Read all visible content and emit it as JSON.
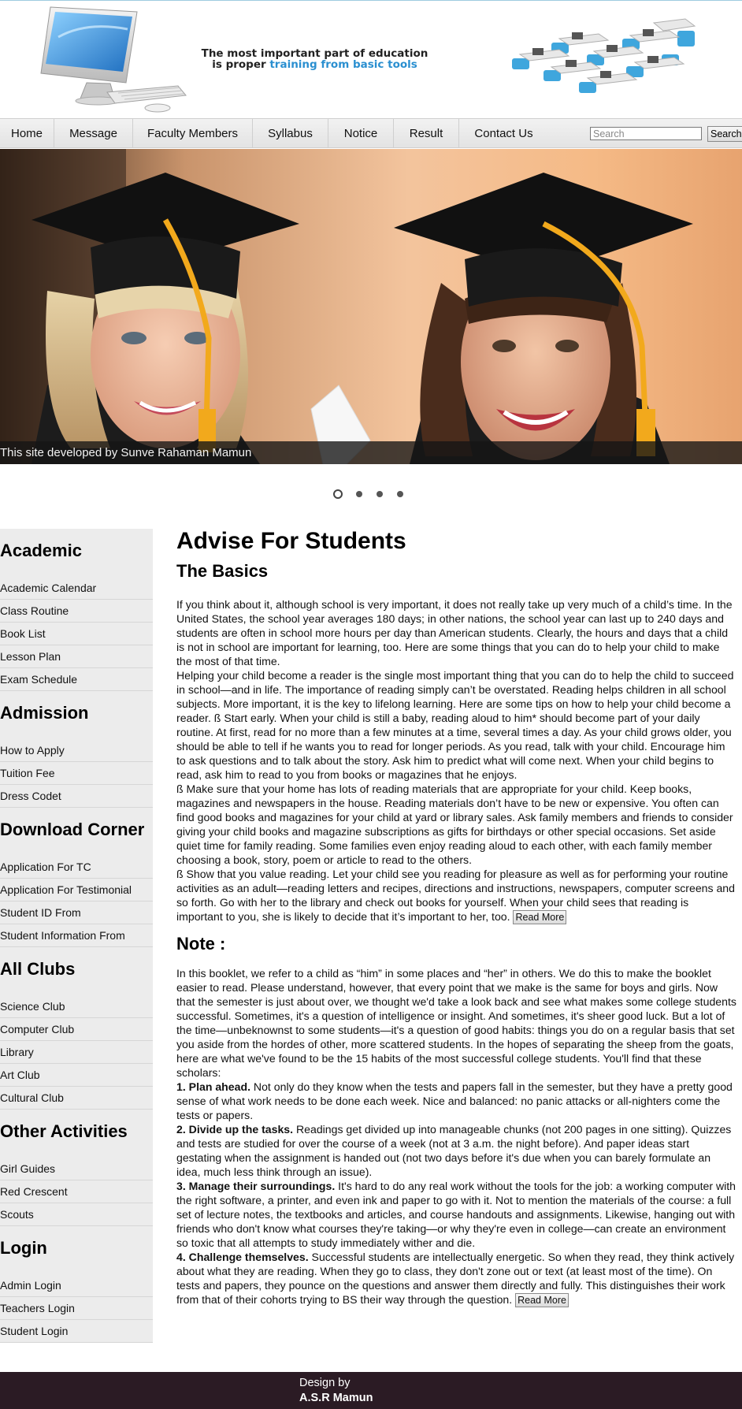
{
  "header": {
    "tagline_line1": "The most important part of education",
    "tagline_prefix": "is proper ",
    "tagline_highlight": "training from basic tools"
  },
  "nav": {
    "items": [
      "Home",
      "Message",
      "Faculty Members",
      "Syllabus",
      "Notice",
      "Result",
      "Contact Us"
    ],
    "search_placeholder": "Search",
    "search_button": "Search"
  },
  "slider": {
    "caption": "This site developed by Sunve Rahaman Mamun",
    "slide_count": 4,
    "active_slide": 1
  },
  "sidebar": {
    "sections": [
      {
        "title": "Academic",
        "links": [
          "Academic Calendar",
          "Class Routine",
          "Book List",
          "Lesson Plan",
          "Exam Schedule"
        ]
      },
      {
        "title": "Admission",
        "links": [
          "How to Apply",
          "Tuition Fee",
          "Dress Codet"
        ]
      },
      {
        "title": "Download Corner",
        "links": [
          "Application For TC",
          "Application For Testimonial",
          "Student ID From",
          "Student Information From"
        ]
      },
      {
        "title": "All Clubs",
        "links": [
          "Science Club",
          "Computer Club",
          "Library",
          "Art Club",
          "Cultural Club"
        ]
      },
      {
        "title": "Other Activities",
        "links": [
          "Girl Guides",
          "Red Crescent",
          "Scouts"
        ]
      },
      {
        "title": "Login",
        "links": [
          "Admin Login",
          "Teachers Login",
          "Student Login"
        ]
      }
    ]
  },
  "main": {
    "title": "Advise For Students",
    "subtitle": "The Basics",
    "basics_paragraphs": [
      "If you think about it, although school is very important, it does not really take up very much of a child’s time. In the United States, the school year averages 180 days; in other nations, the school year can last up to 240 days and students are often in school more hours per day than American students. Clearly, the hours and days that a child is not in school are important for learning, too. Here are some things that you can do to help your child to make the most of that time.",
      "Helping your child become a reader is the single most important thing that you can do to help the child to succeed in school—and in life. The importance of reading simply can’t be overstated. Reading helps children in all school subjects. More important, it is the key to lifelong learning. Here are some tips on how to help your child become a reader. ß Start early. When your child is still a baby, reading aloud to him* should become part of your daily routine. At first, read for no more than a few minutes at a time, several times a day. As your child grows older, you should be able to tell if he wants you to read for longer periods. As you read, talk with your child. Encourage him to ask questions and to talk about the story. Ask him to predict what will come next. When your child begins to read, ask him to read to you from books or magazines that he enjoys.",
      "ß Make sure that your home has lots of reading materials that are appropriate for your child. Keep books, magazines and newspapers in the house. Reading materials don’t have to be new or expensive. You often can find good books and magazines for your child at yard or library sales. Ask family members and friends to consider giving your child books and magazine subscriptions as gifts for birthdays or other special occasions. Set aside quiet time for family reading. Some families even enjoy reading aloud to each other, with each family member choosing a book, story, poem or article to read to the others.",
      "ß Show that you value reading. Let your child see you reading for pleasure as well as for performing your routine activities as an adult—reading letters and recipes, directions and instructions, newspapers, computer screens and so forth. Go with her to the library and check out books for yourself. When your child sees that reading is important to you, she is likely to decide that it’s important to her, too."
    ],
    "read_more_1": "Read More",
    "note_title": "Note :",
    "note_intro": "In this booklet, we refer to a child as “him” in some places and “her” in others. We do this to make the booklet easier to read. Please understand, however, that every point that we make is the same for boys and girls. Now that the semester is just about over, we thought we'd take a look back and see what makes some college students successful. Sometimes, it's a question of intelligence or insight. And sometimes, it's sheer good luck. But a lot of the time—unbeknownst to some students—it's a question of good habits: things you do on a regular basis that set you aside from the hordes of other, more scattered students. In the hopes of separating the sheep from the goats, here are what we've found to be the 15 habits of the most successful college students. You'll find that these scholars:",
    "habits": [
      {
        "heading": "1. Plan ahead.",
        "text": " Not only do they know when the tests and papers fall in the semester, but they have a pretty good sense of what work needs to be done each week. Nice and balanced: no panic attacks or all-nighters come the tests or papers."
      },
      {
        "heading": "2. Divide up the tasks.",
        "text": " Readings get divided up into manageable chunks (not 200 pages in one sitting). Quizzes and tests are studied for over the course of a week (not at 3 a.m. the night before). And paper ideas start gestating when the assignment is handed out (not two days before it's due when you can barely formulate an idea, much less think through an issue)."
      },
      {
        "heading": "3. Manage their surroundings.",
        "text": " It's hard to do any real work without the tools for the job: a working computer with the right software, a printer, and even ink and paper to go with it. Not to mention the materials of the course: a full set of lecture notes, the textbooks and articles, and course handouts and assignments. Likewise, hanging out with friends who don't know what courses they're taking—or why they're even in college—can create an environment so toxic that all attempts to study immediately wither and die."
      },
      {
        "heading": "4. Challenge themselves.",
        "text": " Successful students are intellectually energetic. So when they read, they think actively about what they are reading. When they go to class, they don't zone out or text (at least most of the time). On tests and papers, they pounce on the questions and answer them directly and fully. This distinguishes their work from that of their cohorts trying to BS their way through the question."
      }
    ],
    "read_more_2": "Read More"
  },
  "footer": {
    "line1": "Design by",
    "line2": "A.S.R Mamun"
  }
}
